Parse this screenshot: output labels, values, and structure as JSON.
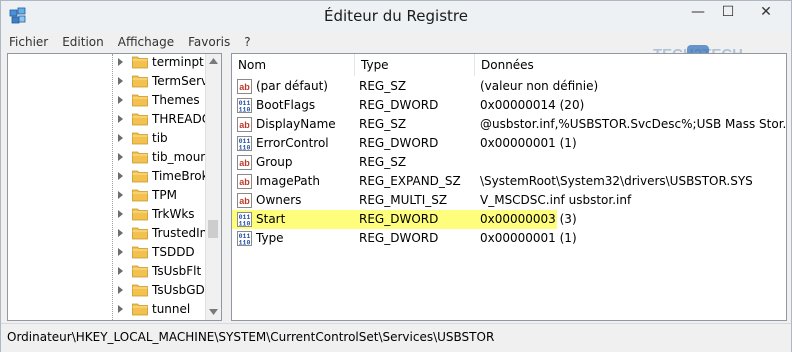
{
  "window": {
    "title": "Éditeur du Registre",
    "controls": {
      "minimize": "—",
      "maximize": "☐",
      "close": "✕"
    }
  },
  "menu": [
    "Fichier",
    "Edition",
    "Affichage",
    "Favoris",
    "?"
  ],
  "logo_text": "TECH2TECH",
  "tree": {
    "items": [
      "terminpt",
      "TermServic",
      "Themes",
      "THREADOF",
      "tib",
      "tib_mounte",
      "TimeBroke",
      "TPM",
      "TrkWks",
      "TrustedInst",
      "TSDDD",
      "TsUsbFlt",
      "TsUsbGD",
      "tunnel"
    ]
  },
  "list": {
    "headers": {
      "name": "Nom",
      "type": "Type",
      "data": "Données"
    },
    "rows": [
      {
        "icon": "string-value-icon",
        "name": "(par défaut)",
        "type": "REG_SZ",
        "data": "(valeur non définie)"
      },
      {
        "icon": "binary-value-icon",
        "name": "BootFlags",
        "type": "REG_DWORD",
        "data": "0x00000014 (20)"
      },
      {
        "icon": "string-value-icon",
        "name": "DisplayName",
        "type": "REG_SZ",
        "data": "@usbstor.inf,%USBSTOR.SvcDesc%;USB Mass Stor..."
      },
      {
        "icon": "binary-value-icon",
        "name": "ErrorControl",
        "type": "REG_DWORD",
        "data": "0x00000001 (1)"
      },
      {
        "icon": "string-value-icon",
        "name": "Group",
        "type": "REG_SZ",
        "data": ""
      },
      {
        "icon": "string-value-icon",
        "name": "ImagePath",
        "type": "REG_EXPAND_SZ",
        "data": "\\SystemRoot\\System32\\drivers\\USBSTOR.SYS"
      },
      {
        "icon": "string-value-icon",
        "name": "Owners",
        "type": "REG_MULTI_SZ",
        "data": "V_MSCDSC.inf usbstor.inf"
      },
      {
        "icon": "binary-value-icon",
        "name": "Start",
        "type": "REG_DWORD",
        "data": "0x00000003 (3)",
        "highlighted": true
      },
      {
        "icon": "binary-value-icon",
        "name": "Type",
        "type": "REG_DWORD",
        "data": "0x00000001 (1)"
      }
    ]
  },
  "status": "Ordinateur\\HKEY_LOCAL_MACHINE\\SYSTEM\\CurrentControlSet\\Services\\USBSTOR",
  "colors": {
    "highlight": "#fefe7c",
    "folder": "#f2c14e",
    "border": "#8f98a3"
  }
}
